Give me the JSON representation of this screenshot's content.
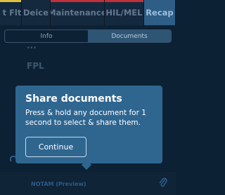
{
  "tabs": [
    {
      "label": "t Flt",
      "stripe": "#e0c040",
      "active": false
    },
    {
      "label": "Deice",
      "stripe": "",
      "active": false
    },
    {
      "label": "Maintenance",
      "stripe": "#c0303a",
      "active": false
    },
    {
      "label": "HIL/MEL",
      "stripe": "#c0303a",
      "active": false
    },
    {
      "label": "Recap",
      "stripe": "",
      "active": true
    }
  ],
  "segment": {
    "info_label": "Info",
    "documents_label": "Documents",
    "selected": "Documents"
  },
  "background_rows": [
    "...",
    "FPL"
  ],
  "popup": {
    "title": "Share documents",
    "body": "Press & hold any document for 1 second to select & share them.",
    "button_label": "Continue"
  },
  "bottom": {
    "notam_label": "NOTAM (Preview)",
    "attach_icon": "paperclip-icon"
  }
}
